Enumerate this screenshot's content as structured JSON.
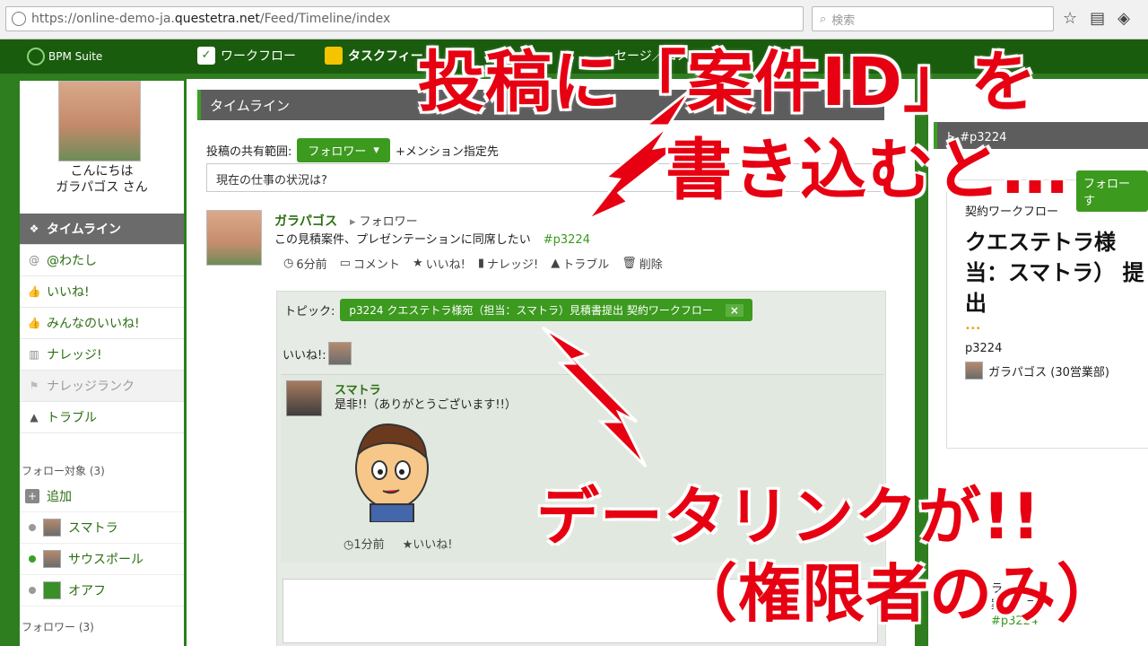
{
  "browser": {
    "url_prefix": "https://online-demo-ja.",
    "url_host": "questetra.net",
    "url_path": "/Feed/Timeline/index",
    "search_placeholder": "検索"
  },
  "header": {
    "logo": "BPM Suite",
    "nav": [
      "ワークフロー",
      "タスクフィー",
      "セージ／コメン"
    ]
  },
  "sidebar": {
    "greeting_line1": "こんにちは",
    "greeting_line2": "ガラパゴス さん",
    "menu": [
      {
        "label": "タイムライン",
        "icon": "timeline-icon"
      },
      {
        "label": "@わたし",
        "icon": "at-icon"
      },
      {
        "label": "いいね!",
        "icon": "thumb-up-icon"
      },
      {
        "label": "みんなのいいね!",
        "icon": "thumbs-up-icon"
      },
      {
        "label": "ナレッジ!",
        "icon": "book-icon"
      },
      {
        "label": "ナレッジランク",
        "icon": "ribbon-icon"
      },
      {
        "label": "トラブル",
        "icon": "warning-icon"
      }
    ],
    "following_title": "フォロー対象 (3)",
    "add_label": "追加",
    "following": [
      {
        "name": "スマトラ"
      },
      {
        "name": "サウスポール"
      },
      {
        "name": "オアフ"
      }
    ],
    "followers_title": "フォロワー (3)"
  },
  "main": {
    "panel_title": "タイムライン",
    "share_label": "投稿の共有範囲:",
    "share_value": "フォロワー",
    "mention_label": "+メンション指定先",
    "input_placeholder": "現在の仕事の状況は?",
    "post": {
      "author": "ガラパゴス",
      "to": "フォロワー",
      "body": "この見積案件、プレゼンテーションに同席したい",
      "tag": "#p3224",
      "time": "6分前",
      "comment": "コメント",
      "like": "いいね!",
      "knowledge": "ナレッジ!",
      "trouble": "トラブル",
      "delete": "削除"
    },
    "thread": {
      "topic_label": "トピック:",
      "topic_chip": "p3224 クエステトラ様宛（担当：スマトラ）見積書提出 契約ワークフロー",
      "likes_label": "いいね!:",
      "reply_author": "スマトラ",
      "reply_body": "是非!!（ありがとうございます!!）",
      "reply_time": "1分前",
      "reply_like": "いいね!"
    }
  },
  "right": {
    "title": "ト    #p3224",
    "follow_btn": "フォロー す",
    "workflow": "契約ワークフロー",
    "heading": "クエステトラ様 当：スマトラ） 提出",
    "dots": "•••",
    "id": "p3224",
    "user": "ガラパゴス (30営業部)",
    "snip1": "ラ",
    "snip2": "案件、プ",
    "snip3": "#p3224"
  },
  "overlay": {
    "line1": "投稿に「案件ID」を",
    "line2": "書き込むと…",
    "line3": "データリンクが!!",
    "line4": "（権限者のみ）"
  },
  "colors": {
    "brand_green": "#3c9a1f",
    "header_green": "#1a5c0e",
    "overlay_red": "#e60012"
  }
}
